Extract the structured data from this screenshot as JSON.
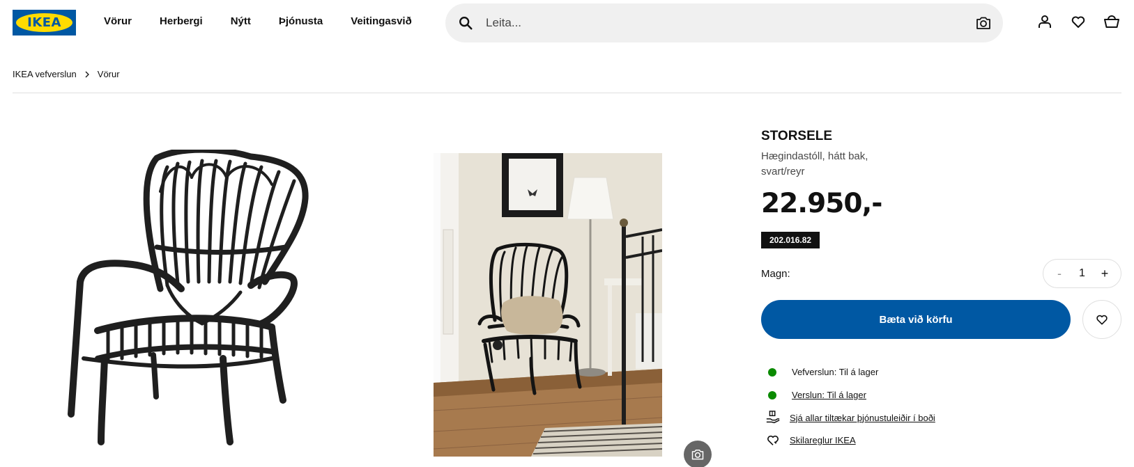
{
  "brand": {
    "logo_text": "IKEA",
    "primary_color": "#0058a3",
    "logo_yellow": "#ffdb00"
  },
  "nav": {
    "items": [
      "Vörur",
      "Herbergi",
      "Nýtt",
      "Þjónusta",
      "Veitingasvið"
    ]
  },
  "search": {
    "placeholder": "Leita...",
    "icon": "search-icon",
    "camera_icon": "camera-icon"
  },
  "header_icons": [
    "user-icon",
    "heart-icon",
    "basket-icon"
  ],
  "breadcrumb": [
    "IKEA vefverslun",
    "Vörur"
  ],
  "product": {
    "name": "STORSELE",
    "description": "Hægindastóll, hátt bak, svart/reyr",
    "price": "22.950,-",
    "article_number": "202.016.82",
    "quantity_label": "Magn:",
    "quantity": "1",
    "qty_minus": "-",
    "qty_plus": "+",
    "add_to_cart": "Bæta við körfu"
  },
  "availability": [
    {
      "text": "Vefverslun: Til á lager",
      "icon": "green-dot",
      "link": false
    },
    {
      "text": "Verslun: Til á lager",
      "icon": "green-dot",
      "link": true
    },
    {
      "text": "Sjá allar tiltækar þjónustuleiðir í boði",
      "icon": "delivery-hand-icon",
      "link": true
    },
    {
      "text": "Skilareglur IKEA",
      "icon": "return-policy-icon",
      "link": true
    }
  ],
  "status_color": "#0a8a00"
}
